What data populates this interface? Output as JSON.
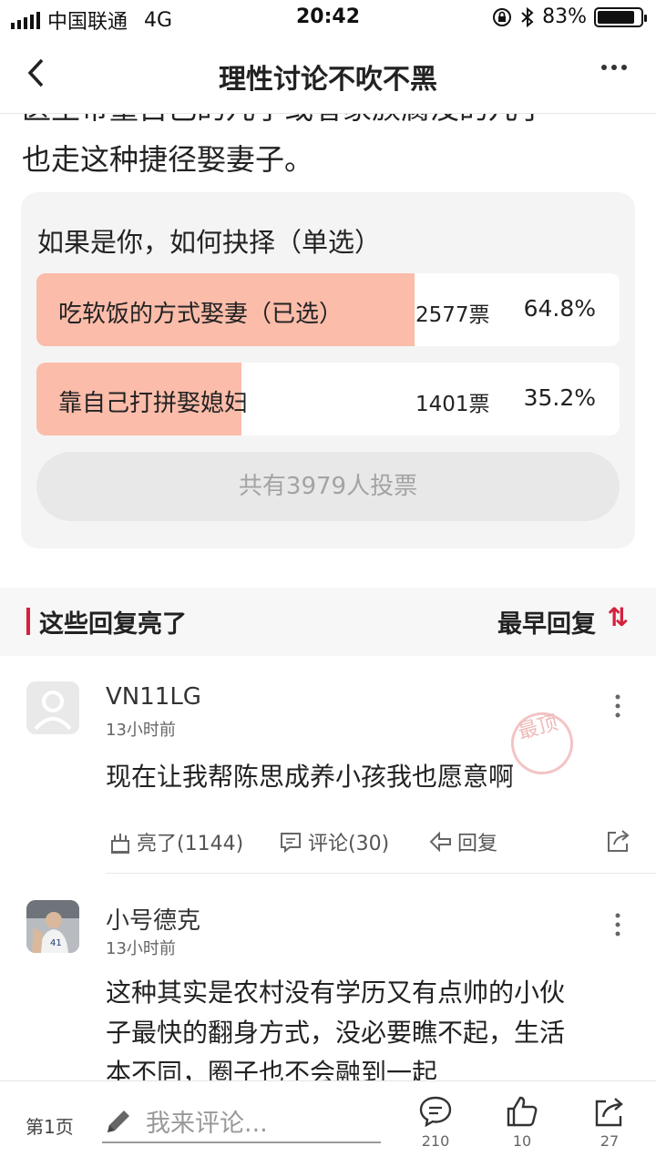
{
  "status_bar": {
    "carrier": "中国联通",
    "network": "4G",
    "time": "20:42",
    "battery": "83%"
  },
  "nav": {
    "title": "理性讨论不吹不黑"
  },
  "article": {
    "partial_line": "医生带童自己的儿子或者家族腐没的儿子",
    "line": "也走这种捷径娶妻子。"
  },
  "poll": {
    "question": "如果是你，如何抉择（单选）",
    "options": [
      {
        "label": "吃软饭的方式娶妻（已选）",
        "votes": "2577票",
        "percent": "64.8%",
        "share": 0.648
      },
      {
        "label": "靠自己打拼娶媳妇",
        "votes": "1401票",
        "percent": "35.2%",
        "share": 0.352
      }
    ],
    "total": "共有3979人投票"
  },
  "section": {
    "title": "这些回复亮了",
    "sort_label": "最早回复",
    "sort_icon": "⇅"
  },
  "comments": [
    {
      "name": "VN11LG",
      "time": "13小时前",
      "text": "现在让我帮陈思成养小孩我也愿意啊",
      "stamp": "最顶",
      "light": "亮了(1144)",
      "comment": "评论(30)",
      "reply": "回复"
    },
    {
      "name": "小号德克",
      "time": "13小时前",
      "lines": [
        "这种其实是农村没有学历又有点帅的小伙",
        "子最快的翻身方式，没必要瞧不起，生活",
        "本不同，圈子也不会融到一起"
      ]
    }
  ],
  "bottom_bar": {
    "page": "第1页",
    "placeholder": "我来评论...",
    "comment_count": "210",
    "like_count": "10",
    "share_count": "27"
  },
  "colors": {
    "accent": "#d4213d",
    "poll_bar": "#fbbcaa"
  }
}
